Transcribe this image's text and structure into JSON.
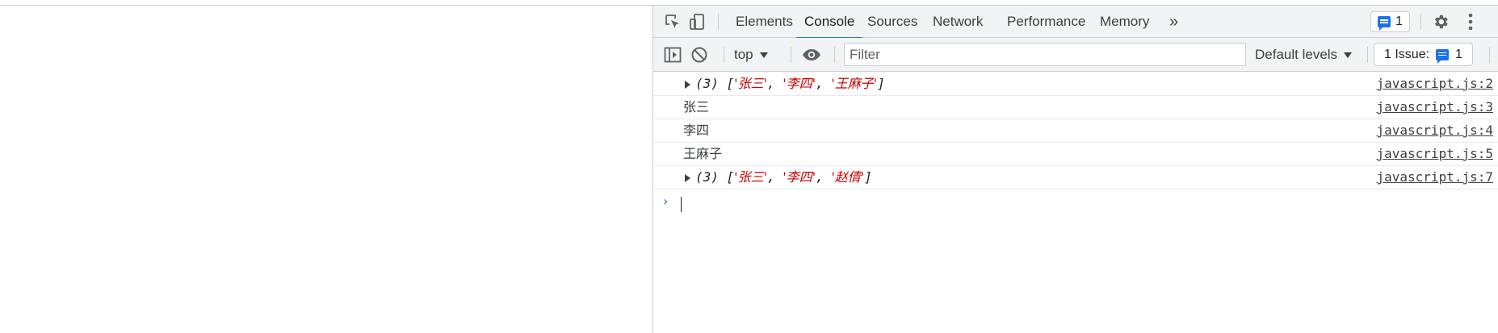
{
  "devtools": {
    "tabs": [
      "Elements",
      "Console",
      "Sources",
      "Network",
      "Performance",
      "Memory"
    ],
    "active_tab": "Console",
    "more_tabs_glyph": "»",
    "messages_badge_count": "1"
  },
  "console_toolbar": {
    "context": "top",
    "filter_placeholder": "Filter",
    "levels_label": "Default levels",
    "issues_label": "1 Issue:",
    "issues_count": "1"
  },
  "console": {
    "rows": [
      {
        "type": "array",
        "count": "(3)",
        "items": [
          "张三",
          "李四",
          "王麻子"
        ],
        "source": "javascript.js:2"
      },
      {
        "type": "text",
        "text": "张三",
        "source": "javascript.js:3"
      },
      {
        "type": "text",
        "text": "李四",
        "source": "javascript.js:4"
      },
      {
        "type": "text",
        "text": "王麻子",
        "source": "javascript.js:5"
      },
      {
        "type": "array",
        "count": "(3)",
        "items": [
          "张三",
          "李四",
          "赵倩"
        ],
        "source": "javascript.js:7"
      }
    ],
    "prompt_glyph": "›"
  },
  "icons": {
    "inspect": "inspect-element-icon",
    "device": "device-toolbar-icon",
    "settings": "gear-icon",
    "more": "kebab-menu-icon",
    "sidebar": "show-sidebar-icon",
    "clear": "clear-console-icon",
    "live_expression": "eye-icon",
    "message": "message-icon"
  },
  "colors": {
    "accent": "#1a73e8",
    "string": "#c80000",
    "toolbar_bg": "#f1f3f4",
    "border": "#cbcdd1"
  }
}
